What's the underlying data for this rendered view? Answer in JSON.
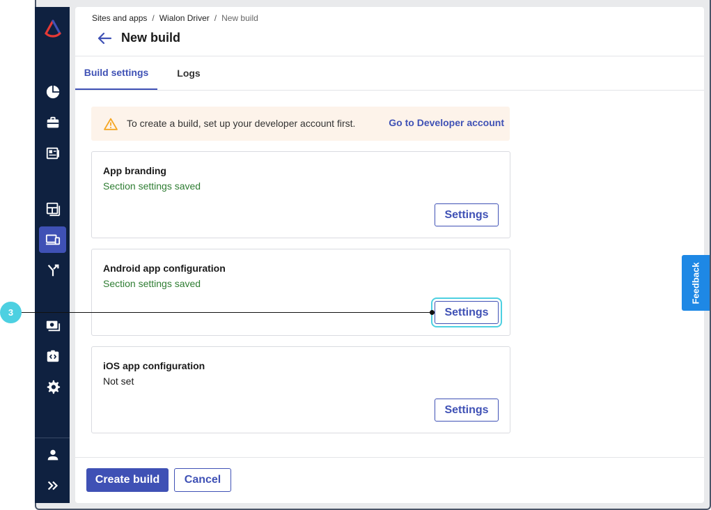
{
  "breadcrumb": {
    "item1": "Sites and apps",
    "sep1": "/",
    "item2": "Wialon Driver",
    "sep2": "/",
    "item3": "New build"
  },
  "page": {
    "title": "New build"
  },
  "tabs": {
    "build_settings": "Build settings",
    "logs": "Logs"
  },
  "warning": {
    "text": "To create a build, set up your developer account first.",
    "link": "Go to Developer account"
  },
  "cards": [
    {
      "title": "App branding",
      "status": "Section settings saved",
      "button": "Settings"
    },
    {
      "title": "Android app configuration",
      "status": "Section settings saved",
      "button": "Settings"
    },
    {
      "title": "iOS app configuration",
      "status": "Not set",
      "button": "Settings"
    }
  ],
  "footer": {
    "create_label": "Create build",
    "cancel_label": "Cancel"
  },
  "feedback_label": "Feedback",
  "callout": {
    "number": "3"
  },
  "sidebar": {
    "icons": [
      "logo-icon",
      "pie-chart-icon",
      "briefcase-icon",
      "news-icon",
      "layout-icon",
      "devices-icon",
      "merge-icon",
      "money-icon",
      "code-icon",
      "gear-icon",
      "user-icon",
      "expand-icon"
    ],
    "active": "devices-icon"
  },
  "colors": {
    "accent": "#3f51b5",
    "sidebar": "#0f2140",
    "success": "#2e7d32",
    "warning_bg": "#fdf3ea",
    "callout": "#4dd0e1",
    "feedback": "#1e88e5"
  }
}
